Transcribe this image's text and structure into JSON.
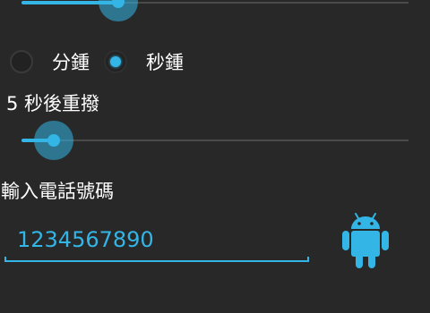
{
  "colors": {
    "accent": "#33b5e5",
    "background": "#282828",
    "text": "#ffffff",
    "track": "#4a4a4a"
  },
  "top_slider": {
    "value_fraction": 0.24
  },
  "unit_radio": {
    "options": [
      {
        "label": "分鍾",
        "checked": false
      },
      {
        "label": "秒鍾",
        "checked": true
      }
    ]
  },
  "redial": {
    "label": "5 秒後重撥",
    "slider_value_fraction": 0.08
  },
  "phone": {
    "label": "輸入電話號碼",
    "value": "1234567890"
  },
  "icons": {
    "app_icon": "android-robot-icon"
  }
}
